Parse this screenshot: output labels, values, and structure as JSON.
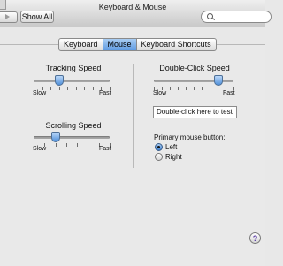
{
  "window": {
    "title": "Keyboard & Mouse"
  },
  "toolbar": {
    "show_all_label": "Show All",
    "search_value": ""
  },
  "tabs": [
    {
      "label": "Keyboard",
      "active": false
    },
    {
      "label": "Mouse",
      "active": true
    },
    {
      "label": "Keyboard Shortcuts",
      "active": false
    }
  ],
  "tracking": {
    "title": "Tracking Speed",
    "min_label": "Slow",
    "max_label": "Fast",
    "value": 0.34
  },
  "scrolling": {
    "title": "Scrolling Speed",
    "min_label": "Slow",
    "max_label": "Fast",
    "value": 0.29
  },
  "double_click": {
    "title": "Double-Click Speed",
    "min_label": "Slow",
    "max_label": "Fast",
    "value": 0.81
  },
  "test_field": {
    "text": "Double-click here to test"
  },
  "primary_button": {
    "label": "Primary mouse button:",
    "options": [
      "Left",
      "Right"
    ],
    "selected": "Left"
  },
  "help": {
    "label": "?"
  },
  "colors": {
    "accent": "#5f9be2",
    "help_glyph": "#5a3ba6"
  }
}
